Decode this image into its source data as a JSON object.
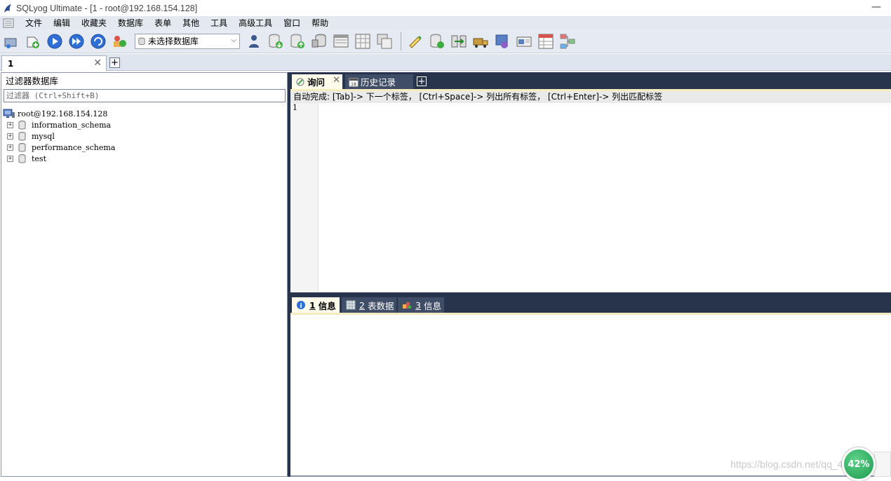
{
  "window": {
    "title": "SQLyog Ultimate - [1 - root@192.168.154.128]",
    "minimize": "—"
  },
  "menu": [
    "文件",
    "编辑",
    "收藏夹",
    "数据库",
    "表单",
    "其他",
    "工具",
    "高级工具",
    "窗口",
    "帮助"
  ],
  "toolbar": {
    "db_select": "未选择数据库"
  },
  "conn_tab": {
    "label": "1",
    "close": "✕",
    "add": "+"
  },
  "left_panel": {
    "header": "过滤器数据库",
    "filter_placeholder": "过滤器 (Ctrl+Shift+B)",
    "root": "root@192.168.154.128",
    "databases": [
      "information_schema",
      "mysql",
      "performance_schema",
      "test"
    ]
  },
  "editor": {
    "tabs": [
      "询问",
      "历史记录"
    ],
    "tab_close": "✕",
    "add": "+",
    "hint": "自动完成: [Tab]-> 下一个标签， [Ctrl+Space]-> 列出所有标签， [Ctrl+Enter]-> 列出匹配标签",
    "line_numbers": [
      "1"
    ]
  },
  "results": {
    "tabs": [
      {
        "num": "1",
        "label": "信息"
      },
      {
        "num": "2",
        "label": "表数据"
      },
      {
        "num": "3",
        "label": "信息"
      }
    ]
  },
  "watermark": "https://blog.csdn.net/qq_45674994",
  "float_badge": "42%",
  "colors": {
    "dark_bar": "#27344c",
    "menu_bg": "#e4e9f1",
    "tab_active": "#fffbea"
  }
}
